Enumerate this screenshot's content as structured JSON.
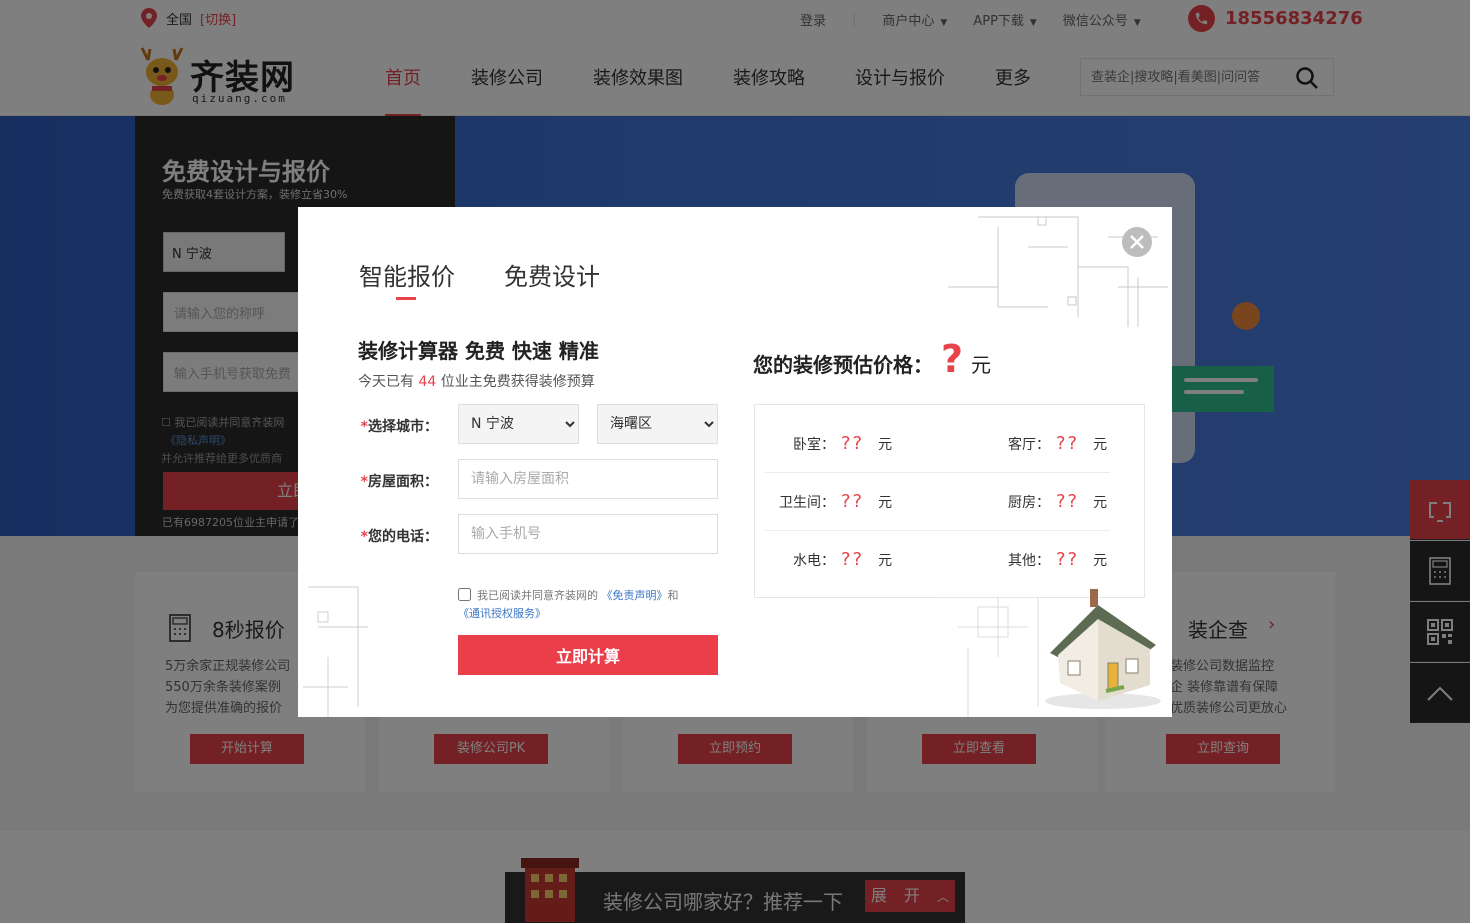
{
  "header": {
    "city": "全国",
    "switch": "[切换]",
    "links": [
      {
        "label": "登录",
        "dropdown": false
      },
      {
        "label": "商户中心",
        "dropdown": true
      },
      {
        "label": "APP下载",
        "dropdown": true
      },
      {
        "label": "微信公众号",
        "dropdown": true
      }
    ],
    "phone": "18556834276"
  },
  "logo": {
    "name": "齐装网",
    "domain": "qizuang.com"
  },
  "nav": {
    "items": [
      "首页",
      "装修公司",
      "装修效果图",
      "装修攻略",
      "设计与报价",
      "更多"
    ],
    "active_index": 0
  },
  "search": {
    "placeholder": "查装企|搜攻略|看美图|问问答"
  },
  "banner": {
    "form_title": "免费设计与报价",
    "form_subtitle": "免费获取4套设计方案，装修立省30%",
    "city_select": "N 宁波",
    "name_placeholder": "请输入您的称呼",
    "phone_placeholder": "输入手机号获取免费",
    "agree_text": "我已阅读并同意齐装网",
    "agree_link": "《隐私声明》",
    "agree_text2": "并允许推荐给更多优质商",
    "button": "立即",
    "applicants": "已有6987205位业主申请了"
  },
  "services": [
    {
      "title": "8秒报价",
      "desc": [
        "5万余家正规装修公司",
        "550万余条装修案例",
        "为您提供准确的报价"
      ],
      "button": "开始计算"
    },
    {
      "title": "",
      "desc": [],
      "button": "装修公司PK"
    },
    {
      "title": "",
      "desc": [],
      "button": "立即预约"
    },
    {
      "title": "",
      "desc": [],
      "button": "立即查看"
    },
    {
      "title": "装企查",
      "desc": [
        "装修公司数据监控",
        "企 装修靠谱有保障",
        "优质装修公司更放心"
      ],
      "button": "立即查询"
    }
  ],
  "promo": {
    "text": "装修公司哪家好？推荐一下",
    "expand": "展 开"
  },
  "modal": {
    "tabs": [
      "智能报价",
      "免费设计"
    ],
    "active_tab": 0,
    "heading": "装修计算器 免费 快速 精准",
    "sub_prefix": "今天已有",
    "sub_count": "44",
    "sub_suffix": "位业主免费获得装修预算",
    "labels": {
      "city": "选择城市：",
      "area": "房屋面积：",
      "phone": "您的电话："
    },
    "required_mark": "*",
    "city": "N 宁波",
    "district": "海曙区",
    "area_placeholder": "请输入房屋面积",
    "phone_placeholder": "输入手机号",
    "agree_text": "我已阅读并同意齐装网的",
    "agree_link1": "《免责声明》",
    "agree_and": "和",
    "agree_link2": "《通讯授权服务》",
    "submit": "立即计算",
    "result_title": "您的装修预估价格：",
    "result_value": "?",
    "result_unit": "元",
    "prices": [
      [
        {
          "label": "卧室：",
          "value": "??",
          "unit": "元"
        },
        {
          "label": "客厅：",
          "value": "??",
          "unit": "元"
        }
      ],
      [
        {
          "label": "卫生间：",
          "value": "??",
          "unit": "元"
        },
        {
          "label": "厨房：",
          "value": "??",
          "unit": "元"
        }
      ],
      [
        {
          "label": "水电：",
          "value": "??",
          "unit": "元"
        },
        {
          "label": "其他：",
          "value": "??",
          "unit": "元"
        }
      ]
    ]
  },
  "colors": {
    "accent": "#e8434b",
    "dark": "#2b2b2b",
    "link": "#3a76c4"
  }
}
